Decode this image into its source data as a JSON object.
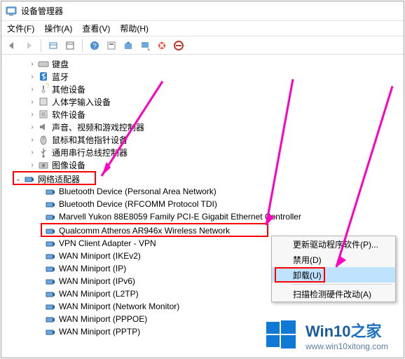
{
  "window": {
    "title": "设备管理器"
  },
  "menubar": {
    "file": "文件(F)",
    "action": "操作(A)",
    "view": "查看(V)",
    "help": "帮助(H)"
  },
  "tree": {
    "categories": [
      {
        "label": "键盘",
        "icon": "keyboard",
        "expanded": false
      },
      {
        "label": "蓝牙",
        "icon": "bluetooth",
        "expanded": false
      },
      {
        "label": "其他设备",
        "icon": "other",
        "expanded": false
      },
      {
        "label": "人体学输入设备",
        "icon": "hid",
        "expanded": false
      },
      {
        "label": "软件设备",
        "icon": "software",
        "expanded": false
      },
      {
        "label": "声音、视频和游戏控制器",
        "icon": "sound",
        "expanded": false
      },
      {
        "label": "鼠标和其他指针设备",
        "icon": "mouse",
        "expanded": false
      },
      {
        "label": "通用串行总线控制器",
        "icon": "usb",
        "expanded": false
      },
      {
        "label": "图像设备",
        "icon": "camera",
        "expanded": false
      }
    ],
    "network": {
      "label": "网络适配器",
      "icon": "net",
      "expanded": true,
      "children": [
        {
          "label": "Bluetooth Device (Personal Area Network)"
        },
        {
          "label": "Bluetooth Device (RFCOMM Protocol TDI)"
        },
        {
          "label": "Marvell Yukon 88E8059 Family PCI-E Gigabit Ethernet Controller"
        },
        {
          "label": "Qualcomm Atheros AR946x Wireless Network",
          "highlighted": true
        },
        {
          "label": "VPN Client Adapter - VPN"
        },
        {
          "label": "WAN Miniport (IKEv2)"
        },
        {
          "label": "WAN Miniport (IP)"
        },
        {
          "label": "WAN Miniport (IPv6)"
        },
        {
          "label": "WAN Miniport (L2TP)"
        },
        {
          "label": "WAN Miniport (Network Monitor)"
        },
        {
          "label": "WAN Miniport (PPPOE)"
        },
        {
          "label": "WAN Miniport (PPTP)"
        }
      ]
    }
  },
  "context_menu": {
    "update": "更新驱动程序软件(P)...",
    "disable": "禁用(D)",
    "uninstall": "卸载(U)",
    "scan": "扫描检测硬件改动(A)"
  },
  "watermark": {
    "brand_main": "Win10",
    "brand_sub": "之家",
    "url": "www.win10xitong.com"
  }
}
